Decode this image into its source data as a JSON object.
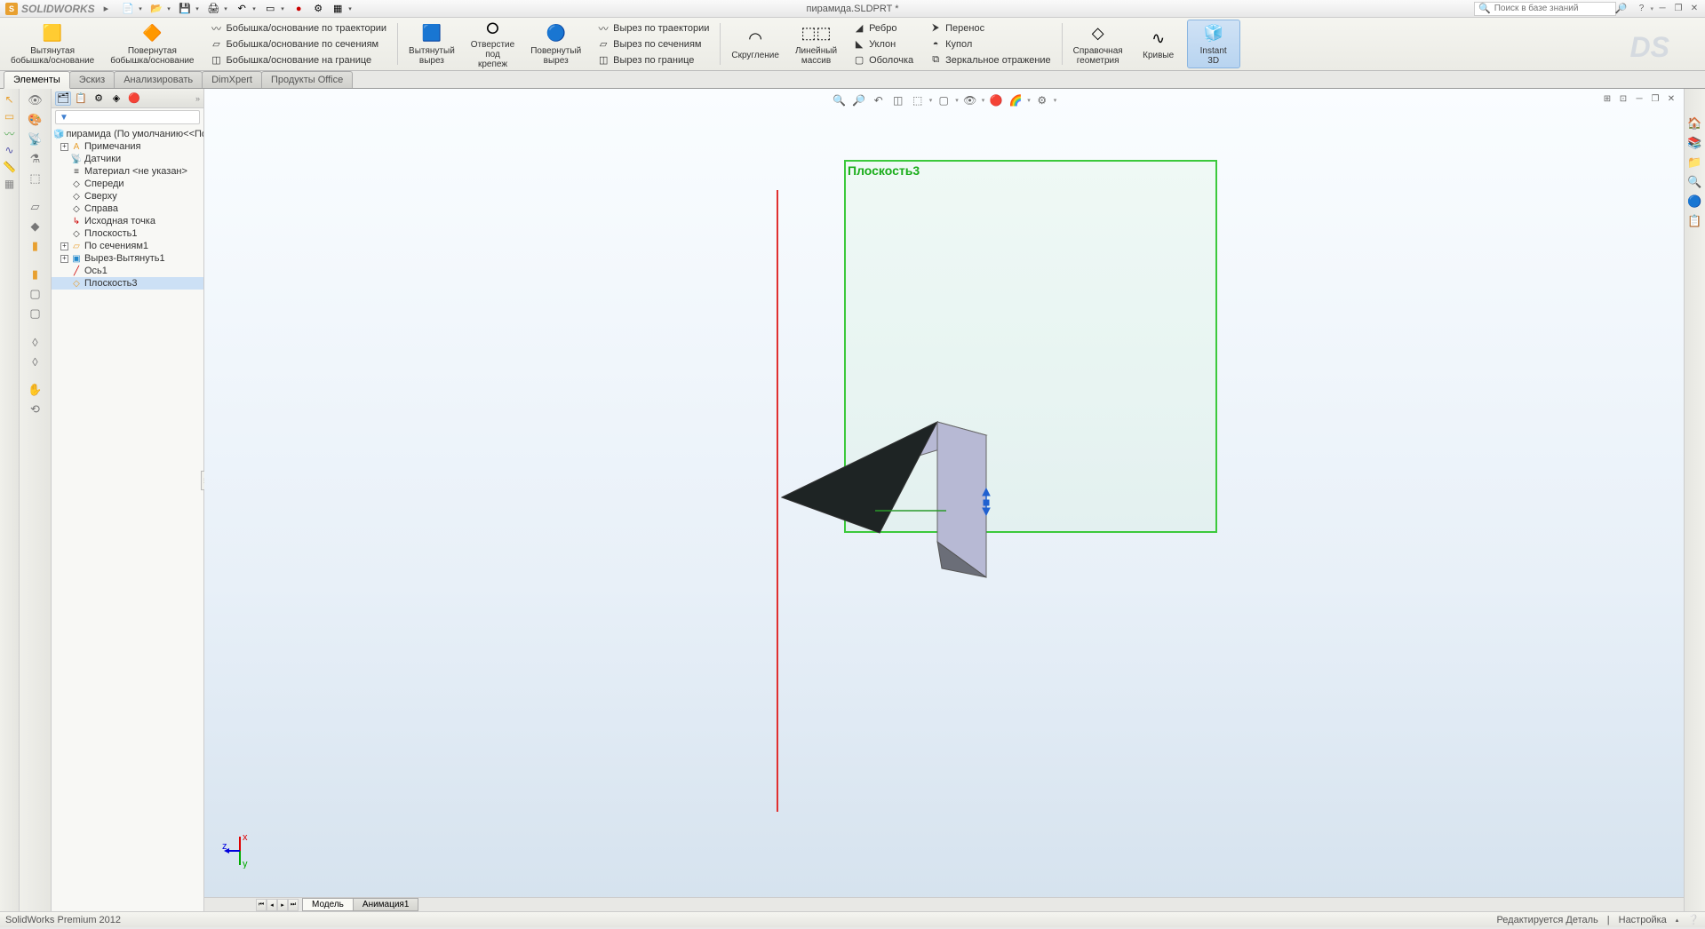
{
  "app": {
    "name": "SOLIDWORKS",
    "doc_title": "пирамида.SLDPRT *"
  },
  "search": {
    "placeholder": "Поиск в базе знаний"
  },
  "ribbon": {
    "extruded_boss": "Вытянутая\nбобышка/основание",
    "revolved_boss": "Повернутая\nбобышка/основание",
    "swept_boss": "Бобышка/основание по траектории",
    "lofted_boss": "Бобышка/основание по сечениям",
    "boundary_boss": "Бобышка/основание на границе",
    "extruded_cut": "Вытянутый\nвырез",
    "hole_wizard": "Отверстие\nпод\nкрепеж",
    "revolved_cut": "Повернутый\nвырез",
    "swept_cut": "Вырез по траектории",
    "lofted_cut": "Вырез по сечениям",
    "boundary_cut": "Вырез по границе",
    "fillet": "Скругление",
    "linear_pattern": "Линейный\nмассив",
    "rib": "Ребро",
    "draft": "Уклон",
    "shell": "Оболочка",
    "wrap": "Перенос",
    "dome": "Купол",
    "mirror": "Зеркальное отражение",
    "ref_geometry": "Справочная\nгеометрия",
    "curves": "Кривые",
    "instant3d": "Instant\n3D"
  },
  "tabs": {
    "features": "Элементы",
    "sketch": "Эскиз",
    "evaluate": "Анализировать",
    "dimxpert": "DimXpert",
    "office": "Продукты Office"
  },
  "tree": {
    "root": "пирамида  (По умолчанию<<По умол",
    "annotations": "Примечания",
    "sensors": "Датчики",
    "material": "Материал <не указан>",
    "front": "Спереди",
    "top": "Сверху",
    "right_plane": "Справа",
    "origin": "Исходная точка",
    "plane1": "Плоскость1",
    "loft1": "По сечениям1",
    "cut_extrude1": "Вырез-Вытянуть1",
    "axis1": "Ось1",
    "plane3": "Плоскость3"
  },
  "viewport": {
    "plane_label": "Плоскость3"
  },
  "bottom_tabs": {
    "model": "Модель",
    "animation": "Анимация1"
  },
  "statusbar": {
    "version": "SolidWorks Premium 2012",
    "editing": "Редактируется Деталь",
    "custom": "Настройка"
  }
}
